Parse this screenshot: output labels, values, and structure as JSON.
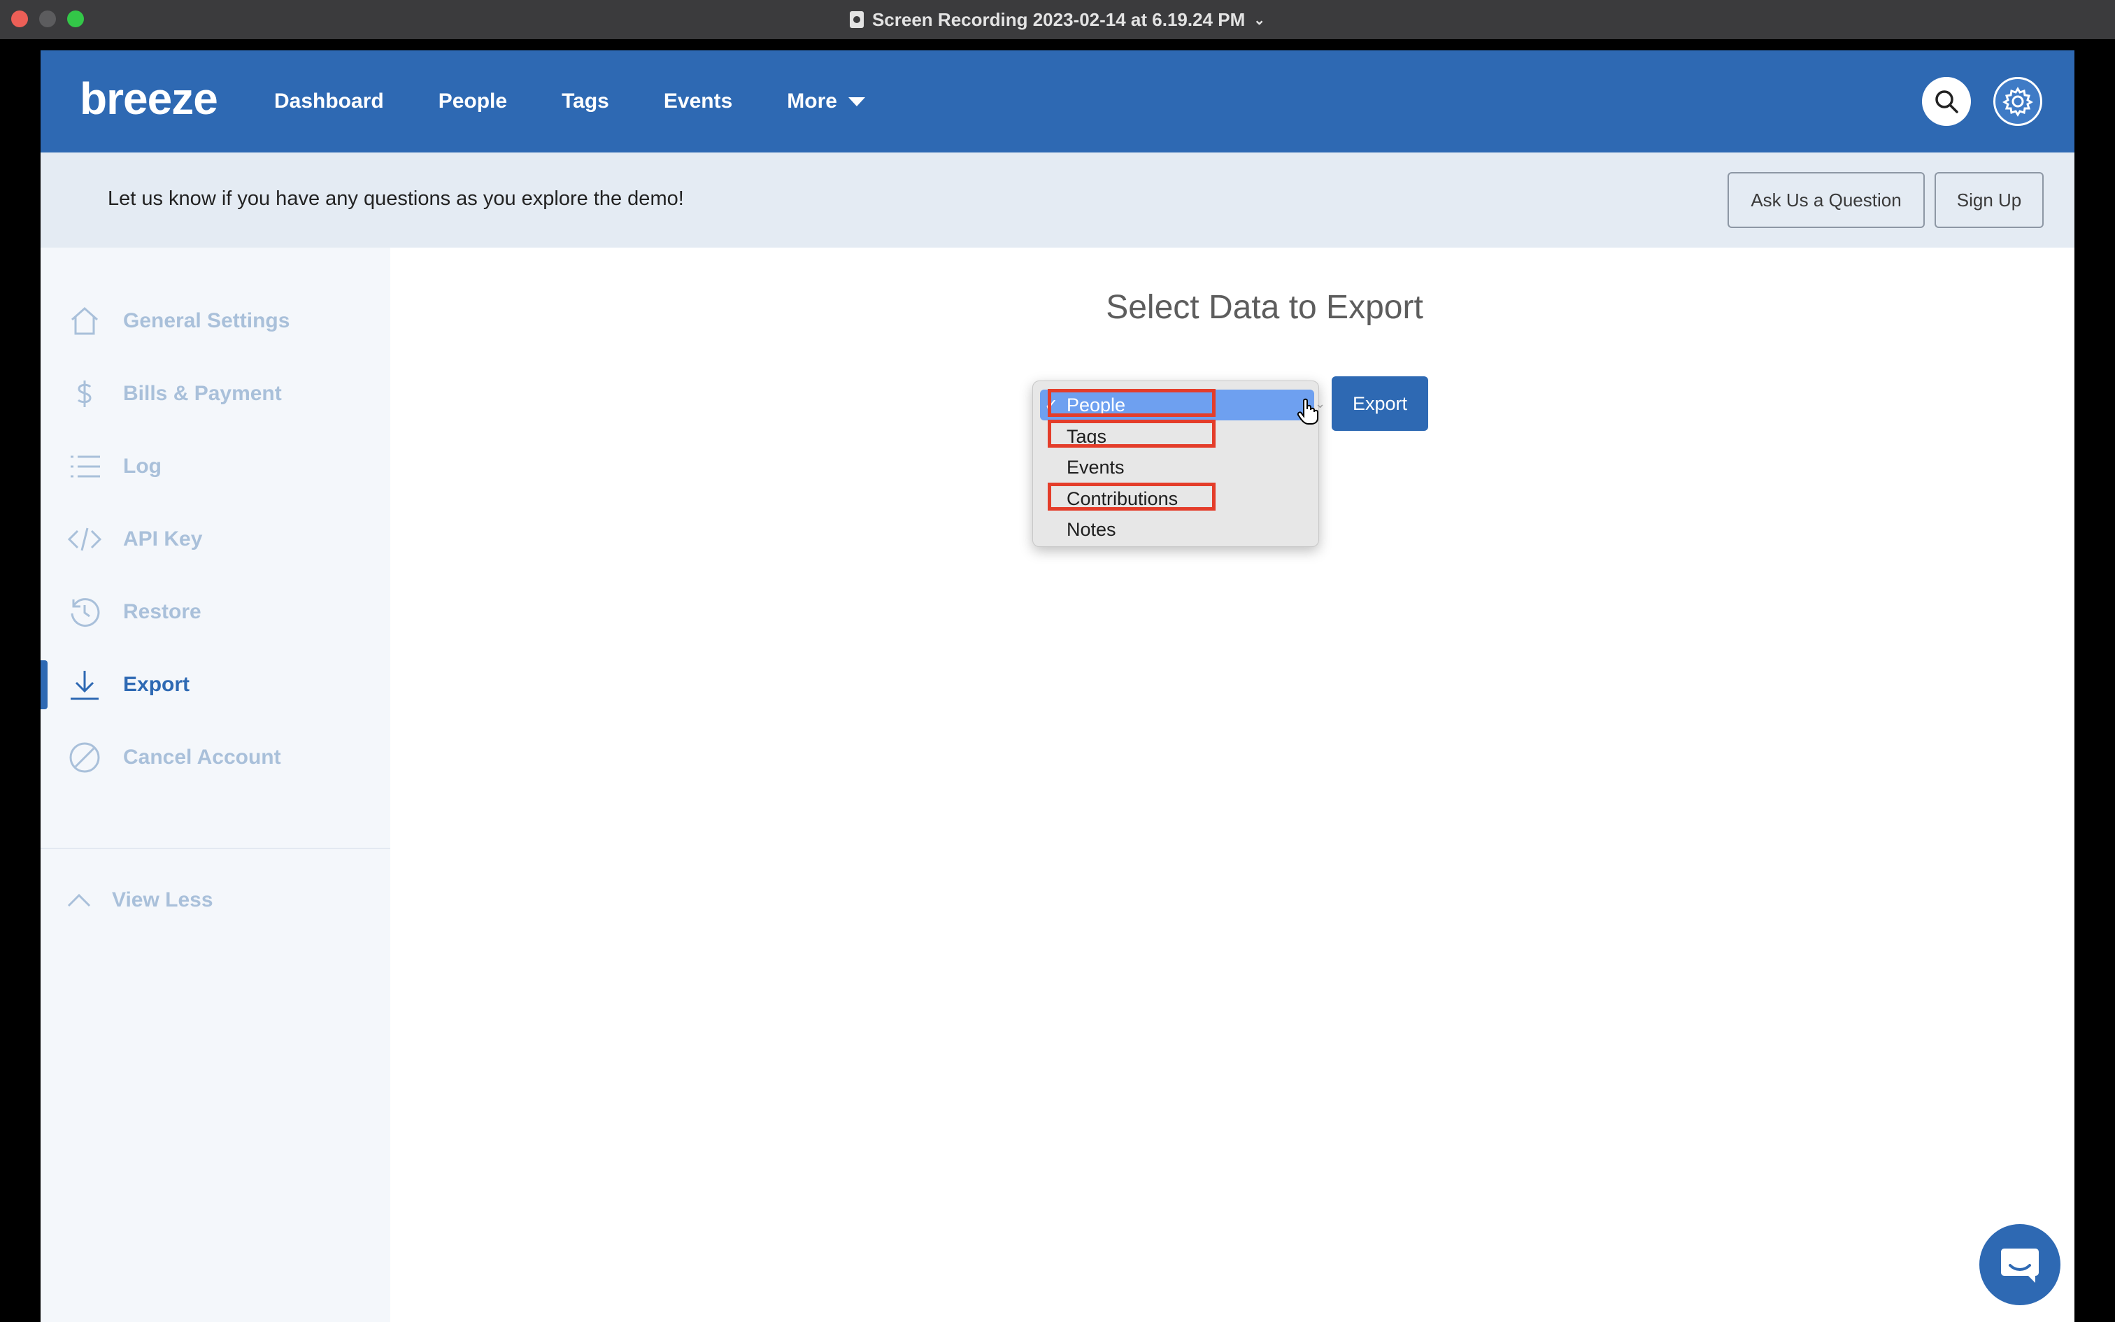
{
  "window": {
    "title": "Screen Recording 2023-02-14 at 6.19.24 PM"
  },
  "nav": {
    "logo": "breeze",
    "links": [
      "Dashboard",
      "People",
      "Tags",
      "Events"
    ],
    "more_label": "More"
  },
  "banner": {
    "message": "Let us know if you have any questions as you explore the demo!",
    "ask_label": "Ask Us a Question",
    "signup_label": "Sign Up"
  },
  "sidebar": {
    "items": [
      {
        "label": "General Settings",
        "icon": "home-icon"
      },
      {
        "label": "Bills & Payment",
        "icon": "dollar-icon"
      },
      {
        "label": "Log",
        "icon": "list-icon"
      },
      {
        "label": "API Key",
        "icon": "code-icon"
      },
      {
        "label": "Restore",
        "icon": "history-icon"
      },
      {
        "label": "Export",
        "icon": "download-icon",
        "active": true
      },
      {
        "label": "Cancel Account",
        "icon": "cancel-icon"
      }
    ],
    "view_less": "View Less"
  },
  "main": {
    "title": "Select Data to Export",
    "export_label": "Export",
    "select": {
      "selected": "People",
      "options": [
        "People",
        "Tags",
        "Events",
        "Contributions",
        "Notes"
      ],
      "highlighted": [
        "People",
        "Tags",
        "Contributions"
      ]
    }
  },
  "colors": {
    "brand": "#2e69b3",
    "banner_bg": "#e4ebf3",
    "sidebar_bg": "#f4f7fb",
    "highlight": "#e43d2a",
    "selected_option": "#6ea0f0"
  }
}
